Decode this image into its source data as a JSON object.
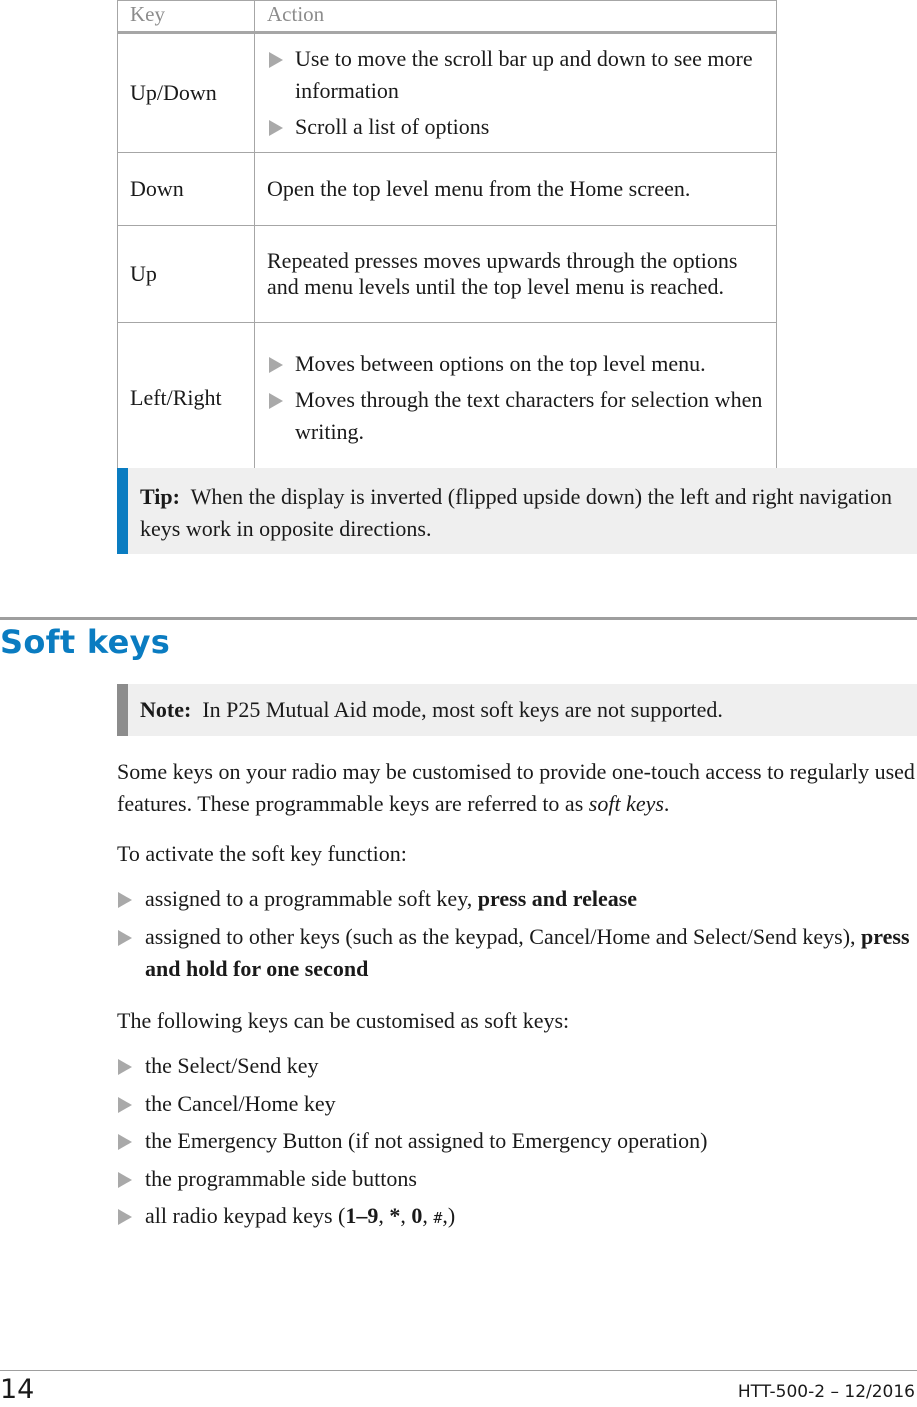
{
  "key_table": {
    "headers": {
      "key": "Key",
      "action": "Action"
    },
    "rows": [
      {
        "key": "Up/Down",
        "type": "bullets",
        "actions": [
          "Use to move the scroll bar up and down to see more information",
          "Scroll a list of options"
        ]
      },
      {
        "key": "Down",
        "type": "text",
        "action": "Open the top level menu from the Home screen."
      },
      {
        "key": "Up",
        "type": "text",
        "action": "Repeated presses moves upwards through the options and menu levels until the top level menu is reached."
      },
      {
        "key": "Left/Right",
        "type": "bullets",
        "actions": [
          "Moves between options on the top level menu.",
          "Moves through the text characters for selection when writing."
        ]
      }
    ]
  },
  "tip": {
    "label": "Tip:",
    "text": "When the display is inverted (flipped upside down) the left and right navigation keys work in opposite directions."
  },
  "section": {
    "title": "Soft keys",
    "note": {
      "label": "Note:",
      "text": "In P25 Mutual Aid mode, most soft keys are not supported."
    },
    "intro": {
      "text": "Some keys on your radio may be customised to provide one-touch access to regularly used features. These programmable keys are referred to as ",
      "emphasis": "soft keys",
      "end": "."
    },
    "activate_intro": "To activate the soft key function:",
    "activate_items": [
      {
        "text": "assigned to a programmable soft key, ",
        "bold": "press and release"
      },
      {
        "text": "assigned to other keys (such as the keypad, Cancel/Home and Select/Send keys), ",
        "bold": "press and hold for one second"
      }
    ],
    "custom_intro": "The following keys can be customised as soft keys:",
    "custom_items": [
      "the Select/Send key",
      "the Cancel/Home key",
      "the Emergency Button (if not assigned to Emergency operation)",
      "the programmable side buttons"
    ],
    "keypad_item": {
      "prefix": "all radio keypad keys (",
      "k1": "1–9",
      "sep1": ", ",
      "k2": "*",
      "sep2": ", ",
      "k3": "0",
      "sep3": ", ",
      "k4": "#",
      "suffix": ",)"
    }
  },
  "footer": {
    "page_number": "14",
    "doc_id": "HTT-500-2 – 12/2016"
  },
  "colors": {
    "accent": "#0a7cc1",
    "note_bar": "#8c8c8c",
    "callout_bg": "#efefef",
    "bullet": "#a9a9a9"
  }
}
